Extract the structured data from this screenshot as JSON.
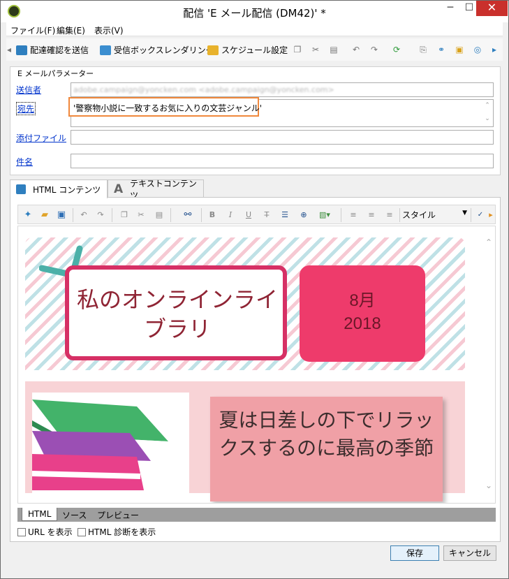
{
  "window": {
    "title": "配信 'E メール配信 (DM42)' *",
    "minimize": "─",
    "maximize": "☐",
    "close": "✕"
  },
  "menu": [
    "ファイル(F)",
    "編集(E)",
    "表示(V)"
  ],
  "toolbar": {
    "send_proof": "配達確認を送信",
    "inbox_render": "受信ボックスレンダリング",
    "schedule": "スケジュール設定"
  },
  "params": {
    "group_title": "E メールパラメーター",
    "sender_label": "送信者",
    "sender_value": "adobe.campaign@yoncken.com <adobe.campaign@yoncken.com>",
    "to_label": "宛先",
    "to_value": "'警察物小説に一致するお気に入りの文芸ジャンル'",
    "attach_label": "添付ファイル",
    "subject_label": "件名"
  },
  "tabs": [
    "HTML コンテンツ",
    "テキストコンテンツ"
  ],
  "editor": {
    "style_label": "スタイル",
    "bold": "B",
    "italic": "I",
    "underline": "U"
  },
  "email": {
    "title": "私のオンラインライブラリ",
    "date_month": "8月",
    "date_year": "2018",
    "quote": "夏は日差しの下でリラックスするのに最高の季節"
  },
  "bottom_tabs": [
    "HTML",
    "ソース",
    "プレビュー"
  ],
  "options": {
    "show_url": "URL を表示",
    "show_diag": "HTML 診断を表示"
  },
  "buttons": {
    "save": "保存",
    "cancel": "キャンセル"
  }
}
